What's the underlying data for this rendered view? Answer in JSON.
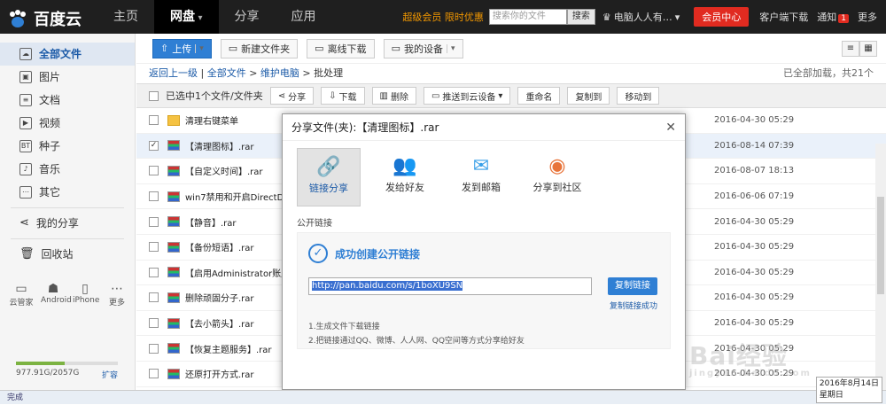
{
  "app": {
    "name": "百度云"
  },
  "nav": {
    "items": [
      "主页",
      "网盘",
      "分享",
      "应用"
    ]
  },
  "topbar": {
    "vip_promo": "超级会员 限时优惠",
    "search_placeholder": "搜索你的文件",
    "search_button": "搜索",
    "username": "电脑人人有…",
    "vip_center": "会员中心",
    "client_download": "客户端下载",
    "notify": "通知",
    "notify_count": "1",
    "more": "更多"
  },
  "sidebar": {
    "items": [
      {
        "label": "全部文件",
        "icon": "cloud-icon"
      },
      {
        "label": "图片",
        "icon": "image-icon"
      },
      {
        "label": "文档",
        "icon": "doc-icon"
      },
      {
        "label": "视频",
        "icon": "video-icon"
      },
      {
        "label": "种子",
        "icon": "bt-icon"
      },
      {
        "label": "音乐",
        "icon": "music-icon"
      },
      {
        "label": "其它",
        "icon": "other-icon"
      }
    ],
    "share": "我的分享",
    "trash": "回收站",
    "devices": [
      "云管家",
      "Android",
      "iPhone",
      "更多"
    ],
    "quota_text": "977.91G/2057G",
    "quota_fraction": 0.475,
    "expand": "扩容"
  },
  "toolbar": {
    "upload": "上传",
    "new_folder": "新建文件夹",
    "offline": "离线下载",
    "my_device": "我的设备"
  },
  "breadcrumb": {
    "back": "返回上一级",
    "root": "全部文件",
    "parent": "维护电脑",
    "current": "批处理",
    "loaded": "已全部加载，共21个"
  },
  "actionbar": {
    "selected": "已选中1个文件/文件夹",
    "share": "分享",
    "download": "下载",
    "delete": "删除",
    "push": "推送到云设备",
    "rename": "重命名",
    "copy": "复制到",
    "move": "移动到"
  },
  "files": [
    {
      "name": "清理右键菜单",
      "date": "2016-04-30 05:29",
      "folder": true,
      "checked": false
    },
    {
      "name": "【清理图标】.rar",
      "date": "2016-08-14 07:39",
      "folder": false,
      "checked": true
    },
    {
      "name": "【自定义时间】.rar",
      "date": "2016-08-07 18:13",
      "folder": false,
      "checked": false
    },
    {
      "name": "win7禁用和开启DirectDraw加",
      "date": "2016-06-06 07:19",
      "folder": false,
      "checked": false
    },
    {
      "name": "【静音】.rar",
      "date": "2016-04-30 05:29",
      "folder": false,
      "checked": false
    },
    {
      "name": "【备份短语】.rar",
      "date": "2016-04-30 05:29",
      "folder": false,
      "checked": false
    },
    {
      "name": "【启用Administrator账户】.r",
      "date": "2016-04-30 05:29",
      "folder": false,
      "checked": false
    },
    {
      "name": "删除顽固分子.rar",
      "date": "2016-04-30 05:29",
      "folder": false,
      "checked": false
    },
    {
      "name": "【去小箭头】.rar",
      "date": "2016-04-30 05:29",
      "folder": false,
      "checked": false
    },
    {
      "name": "【恢复主题服务】.rar",
      "date": "2016-04-30 05:29",
      "folder": false,
      "checked": false
    },
    {
      "name": "还原打开方式.rar",
      "date": "2016-04-30 05:29",
      "folder": false,
      "checked": false
    }
  ],
  "dialog": {
    "title": "分享文件(夹):【清理图标】.rar",
    "tabs": [
      {
        "label": "链接分享",
        "icon": "link-icon",
        "glyph": "🔗"
      },
      {
        "label": "发给好友",
        "icon": "friends-icon",
        "glyph": "👥"
      },
      {
        "label": "发到邮箱",
        "icon": "mail-icon",
        "glyph": "✉"
      },
      {
        "label": "分享到社区",
        "icon": "community-icon",
        "glyph": "◉"
      }
    ],
    "section": "公开链接",
    "success": "成功创建公开链接",
    "link": "http://pan.baidu.com/s/1boXU9SN",
    "copy_button": "复制链接",
    "copy_ok": "复制链接成功",
    "tip1": "1.生成文件下载链接",
    "tip2": "2.把链接通过QQ、微博、人人网、QQ空间等方式分享给好友"
  },
  "status": {
    "text": "完成",
    "date": "2016年8月14日",
    "weekday": "星期日"
  },
  "watermark": {
    "main": "Bai经验",
    "sub": "jingyan.baidu.com"
  }
}
